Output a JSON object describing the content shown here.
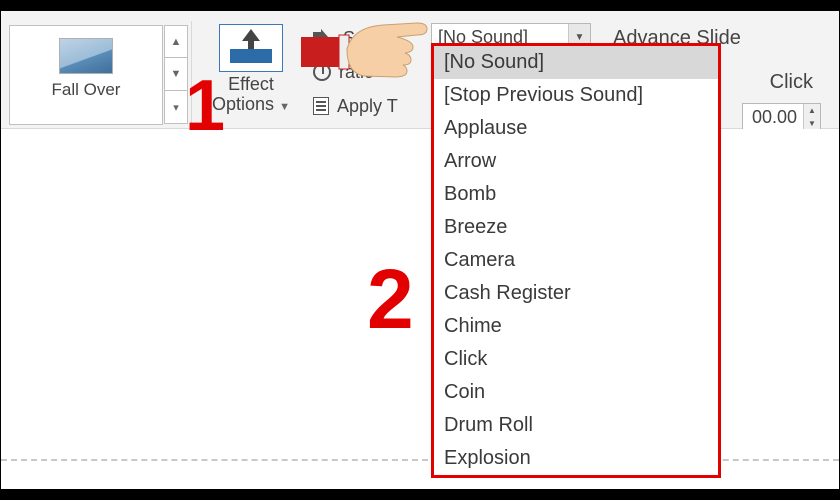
{
  "gallery": {
    "transition_label": "Fall Over"
  },
  "effect_options": {
    "line1": "Effect",
    "line2": "Options"
  },
  "timing": {
    "sound_label_fragment": "Soun",
    "duration_label_fragment": "ratio",
    "apply_label_fragment": "Apply T"
  },
  "sound_select": {
    "value": "[No Sound]"
  },
  "advance": {
    "heading": "Advance Slide",
    "on_click_fragment": "Click",
    "after_value": "00.00"
  },
  "dropdown": {
    "items": [
      "[No Sound]",
      "[Stop Previous Sound]",
      "Applause",
      "Arrow",
      "Bomb",
      "Breeze",
      "Camera",
      "Cash Register",
      "Chime",
      "Click",
      "Coin",
      "Drum Roll",
      "Explosion"
    ],
    "selected_index": 0
  },
  "annotations": {
    "step1": "1",
    "step2": "2"
  },
  "chart_data": null
}
